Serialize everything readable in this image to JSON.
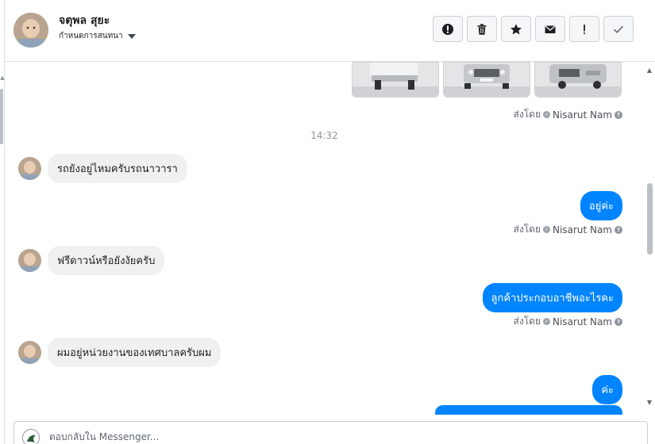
{
  "header": {
    "contact_name": "จตุพล สุยะ",
    "assign_label": "กำหนดการสนทนา"
  },
  "thread": {
    "timestamp": "14:32",
    "sent_by_prefix": "ส่งโดย",
    "sent_by_name": "Nisarut Nam",
    "messages": [
      {
        "from": "customer",
        "text": "รถยังอยู่ไหมครับรถนาวารา"
      },
      {
        "from": "page",
        "text": "อยู่ค่ะ"
      },
      {
        "from": "customer",
        "text": "ฟรีดาวน์หรือยังงัยครับ"
      },
      {
        "from": "page",
        "text": "ลูกค้าประกอบอาชีพอะไรคะ"
      },
      {
        "from": "customer",
        "text": "ผมอยู่หน่วยงานของเทศบาลครับผม"
      },
      {
        "from": "page",
        "text": "ค่ะ"
      }
    ]
  },
  "composer": {
    "placeholder": "ตอบกลับใน Messenger..."
  },
  "colors": {
    "outgoing_bubble": "#0084ff",
    "incoming_bubble": "#f1f0f0",
    "muted_text": "#606770"
  }
}
